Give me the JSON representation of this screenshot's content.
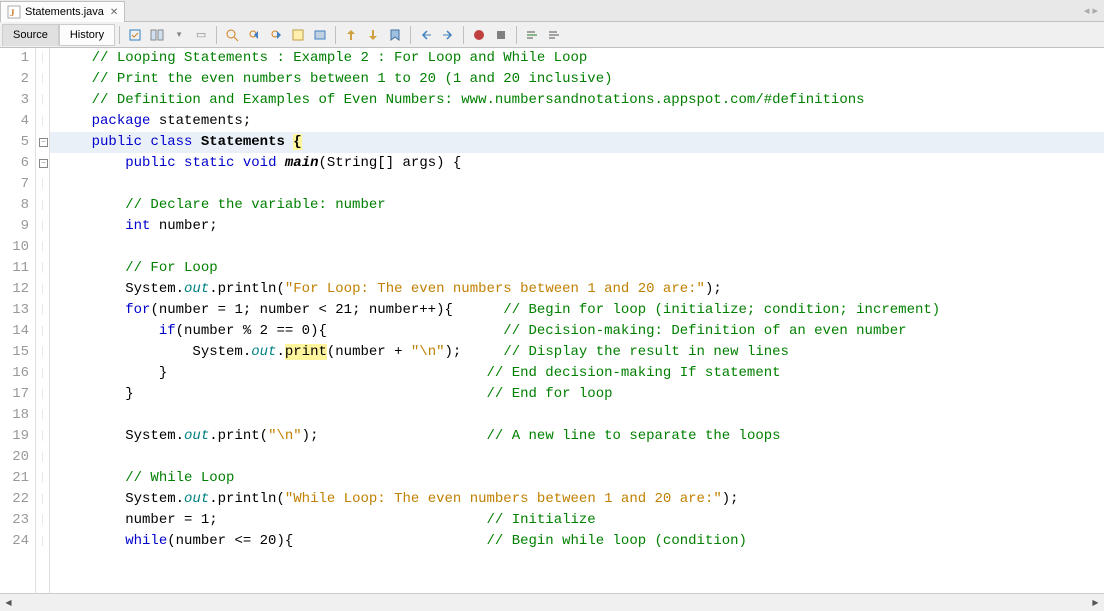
{
  "tab": {
    "title": "Statements.java",
    "icon": "java-file-icon"
  },
  "toolbar": {
    "tabs": {
      "source": "Source",
      "history": "History"
    }
  },
  "code": {
    "lines": [
      {
        "num": "1",
        "type": "comment",
        "indent": "    ",
        "parts": [
          {
            "cls": "c-comment",
            "txt": "// Looping Statements : Example 2 : For Loop and While Loop"
          }
        ]
      },
      {
        "num": "2",
        "type": "comment",
        "indent": "    ",
        "parts": [
          {
            "cls": "c-comment",
            "txt": "// Print the even numbers between 1 to 20 (1 and 20 inclusive)"
          }
        ]
      },
      {
        "num": "3",
        "type": "comment",
        "indent": "    ",
        "parts": [
          {
            "cls": "c-comment",
            "txt": "// Definition and Examples of Even Numbers: www.numbersandnotations.appspot.com/#definitions"
          }
        ]
      },
      {
        "num": "4",
        "type": "code",
        "indent": "    ",
        "parts": [
          {
            "cls": "c-keyword",
            "txt": "package"
          },
          {
            "cls": "",
            "txt": " statements;"
          }
        ]
      },
      {
        "num": "5",
        "type": "code",
        "hl": true,
        "fold": "minus",
        "indent": "    ",
        "parts": [
          {
            "cls": "c-keyword",
            "txt": "public"
          },
          {
            "cls": "",
            "txt": " "
          },
          {
            "cls": "c-keyword",
            "txt": "class"
          },
          {
            "cls": "",
            "txt": " "
          },
          {
            "cls": "c-class-bold",
            "txt": "Statements"
          },
          {
            "cls": "",
            "txt": " "
          },
          {
            "cls": "c-bracket-hl",
            "txt": "{"
          }
        ]
      },
      {
        "num": "6",
        "type": "code",
        "fold": "minus",
        "indent": "        ",
        "parts": [
          {
            "cls": "c-keyword",
            "txt": "public"
          },
          {
            "cls": "",
            "txt": " "
          },
          {
            "cls": "c-keyword",
            "txt": "static"
          },
          {
            "cls": "",
            "txt": " "
          },
          {
            "cls": "c-keyword",
            "txt": "void"
          },
          {
            "cls": "",
            "txt": " "
          },
          {
            "cls": "c-method-bold",
            "txt": "main"
          },
          {
            "cls": "",
            "txt": "(String[] args) {"
          }
        ]
      },
      {
        "num": "7",
        "type": "blank",
        "indent": "",
        "parts": []
      },
      {
        "num": "8",
        "type": "comment",
        "indent": "        ",
        "parts": [
          {
            "cls": "c-comment",
            "txt": "// Declare the variable: number"
          }
        ]
      },
      {
        "num": "9",
        "type": "code",
        "indent": "        ",
        "parts": [
          {
            "cls": "c-keyword",
            "txt": "int"
          },
          {
            "cls": "",
            "txt": " number;"
          }
        ]
      },
      {
        "num": "10",
        "type": "blank",
        "indent": "",
        "parts": []
      },
      {
        "num": "11",
        "type": "comment",
        "indent": "        ",
        "parts": [
          {
            "cls": "c-comment",
            "txt": "// For Loop"
          }
        ]
      },
      {
        "num": "12",
        "type": "code",
        "indent": "        ",
        "parts": [
          {
            "cls": "",
            "txt": "System."
          },
          {
            "cls": "c-static",
            "txt": "out"
          },
          {
            "cls": "",
            "txt": ".println("
          },
          {
            "cls": "c-string",
            "txt": "\"For Loop: The even numbers between 1 and 20 are:\""
          },
          {
            "cls": "",
            "txt": ");"
          }
        ]
      },
      {
        "num": "13",
        "type": "code",
        "indent": "        ",
        "parts": [
          {
            "cls": "c-keyword",
            "txt": "for"
          },
          {
            "cls": "",
            "txt": "(number = 1; number < 21; number++){      "
          },
          {
            "cls": "c-comment",
            "txt": "// Begin for loop (initialize; condition; increment)"
          }
        ]
      },
      {
        "num": "14",
        "type": "code",
        "indent": "            ",
        "parts": [
          {
            "cls": "c-keyword",
            "txt": "if"
          },
          {
            "cls": "",
            "txt": "(number % 2 == 0){                     "
          },
          {
            "cls": "c-comment",
            "txt": "// Decision-making: Definition of an even number"
          }
        ]
      },
      {
        "num": "15",
        "type": "code",
        "indent": "                ",
        "parts": [
          {
            "cls": "",
            "txt": "System."
          },
          {
            "cls": "c-static",
            "txt": "out"
          },
          {
            "cls": "",
            "txt": "."
          },
          {
            "cls": "c-hl-yellow",
            "txt": "print"
          },
          {
            "cls": "",
            "txt": "(number + "
          },
          {
            "cls": "c-string",
            "txt": "\"\\n\""
          },
          {
            "cls": "",
            "txt": ");     "
          },
          {
            "cls": "c-comment",
            "txt": "// Display the result in new lines"
          }
        ]
      },
      {
        "num": "16",
        "type": "code",
        "indent": "            ",
        "parts": [
          {
            "cls": "",
            "txt": "}                                      "
          },
          {
            "cls": "c-comment",
            "txt": "// End decision-making If statement"
          }
        ]
      },
      {
        "num": "17",
        "type": "code",
        "indent": "        ",
        "parts": [
          {
            "cls": "",
            "txt": "}                                          "
          },
          {
            "cls": "c-comment",
            "txt": "// End for loop"
          }
        ]
      },
      {
        "num": "18",
        "type": "blank",
        "indent": "",
        "parts": []
      },
      {
        "num": "19",
        "type": "code",
        "indent": "        ",
        "parts": [
          {
            "cls": "",
            "txt": "System."
          },
          {
            "cls": "c-static",
            "txt": "out"
          },
          {
            "cls": "",
            "txt": ".print("
          },
          {
            "cls": "c-string",
            "txt": "\"\\n\""
          },
          {
            "cls": "",
            "txt": ");                    "
          },
          {
            "cls": "c-comment",
            "txt": "// A new line to separate the loops"
          }
        ]
      },
      {
        "num": "20",
        "type": "blank",
        "indent": "",
        "parts": []
      },
      {
        "num": "21",
        "type": "comment",
        "indent": "        ",
        "parts": [
          {
            "cls": "c-comment",
            "txt": "// While Loop"
          }
        ]
      },
      {
        "num": "22",
        "type": "code",
        "indent": "        ",
        "parts": [
          {
            "cls": "",
            "txt": "System."
          },
          {
            "cls": "c-static",
            "txt": "out"
          },
          {
            "cls": "",
            "txt": ".println("
          },
          {
            "cls": "c-string",
            "txt": "\"While Loop: The even numbers between 1 and 20 are:\""
          },
          {
            "cls": "",
            "txt": ");"
          }
        ]
      },
      {
        "num": "23",
        "type": "code",
        "indent": "        ",
        "parts": [
          {
            "cls": "",
            "txt": "number = 1;                                "
          },
          {
            "cls": "c-comment",
            "txt": "// Initialize"
          }
        ]
      },
      {
        "num": "24",
        "type": "code",
        "indent": "        ",
        "parts": [
          {
            "cls": "c-keyword",
            "txt": "while"
          },
          {
            "cls": "",
            "txt": "(number <= 20){                       "
          },
          {
            "cls": "c-comment",
            "txt": "// Begin while loop (condition)"
          }
        ]
      }
    ]
  }
}
